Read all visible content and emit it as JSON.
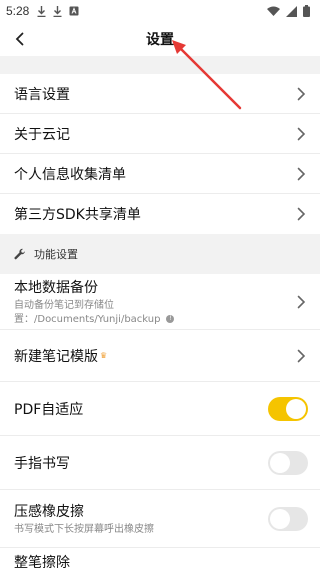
{
  "status_bar": {
    "time": "5:28"
  },
  "header": {
    "title": "设置"
  },
  "about_group": [
    {
      "label": "语言设置"
    },
    {
      "label": "关于云记"
    },
    {
      "label": "个人信息收集清单"
    },
    {
      "label": "第三方SDK共享清单"
    }
  ],
  "section": {
    "title": "功能设置"
  },
  "settings": {
    "backup": {
      "label": "本地数据备份",
      "desc": "自动备份笔记到存储位置：/Documents/Yunji/backup"
    },
    "template": {
      "label": "新建笔记模版"
    },
    "pdf_adapt": {
      "label": "PDF自适应",
      "on": true
    },
    "finger_writing": {
      "label": "手指书写",
      "on": false
    },
    "pressure_eraser": {
      "label": "压感橡皮擦",
      "desc": "书写模式下长按屏幕呼出橡皮擦",
      "on": false
    },
    "partial_next": {
      "label": "整笔擦除"
    }
  },
  "colors": {
    "accent": "#f5c400",
    "annotation": "#e53935"
  }
}
